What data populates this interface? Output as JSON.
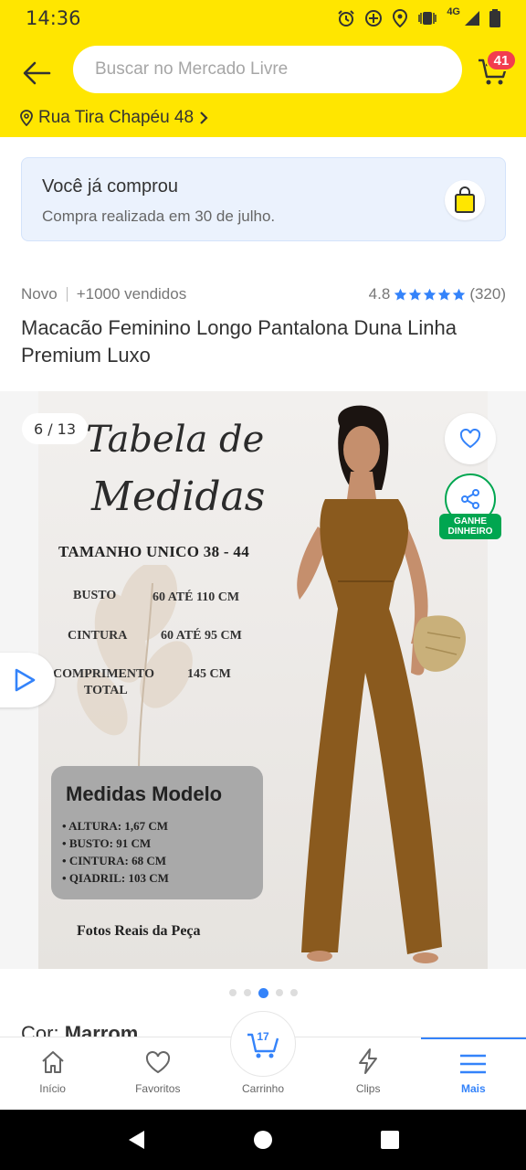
{
  "status_bar": {
    "time": "14:36",
    "network": "4G"
  },
  "header": {
    "search_placeholder": "Buscar no Mercado Livre",
    "cart_badge": "41",
    "address": "Rua Tira Chapéu 48"
  },
  "purchase_card": {
    "title": "Você já comprou",
    "subtitle": "Compra realizada em 30 de julho."
  },
  "product": {
    "condition": "Novo",
    "sold": "+1000 vendidos",
    "rating": "4.8",
    "rating_count": "(320)",
    "title": "Macacão Feminino Longo Pantalona Duna Linha Premium Luxo"
  },
  "gallery": {
    "counter": "6 / 13",
    "share_label_1": "GANHE",
    "share_label_2": "DINHEIRO",
    "image_text": {
      "script_line1": "Tabela de",
      "script_line2": "Medidas",
      "size_heading": "TAMANHO UNICO 38 - 44",
      "rows": [
        {
          "label": "BUSTO",
          "value": "60 ATÉ 110 CM"
        },
        {
          "label": "CINTURA",
          "value": "60 ATÉ 95 CM"
        },
        {
          "label": "COMPRIMENTO",
          "label2": "TOTAL",
          "value": "145 CM"
        }
      ],
      "model_title": "Medidas Modelo",
      "model_items": [
        "ALTURA: 1,67 CM",
        "BUSTO: 91 CM",
        "CINTURA: 68 CM",
        "QIADRIL: 103 CM"
      ],
      "footer": "Fotos Reais da Peça"
    },
    "dots_total": 5,
    "dots_active": 3
  },
  "color": {
    "label": "Cor:",
    "value": "Marrom"
  },
  "bottom_nav": {
    "items": [
      {
        "label": "Início",
        "icon": "home-icon"
      },
      {
        "label": "Favoritos",
        "icon": "heart-icon"
      },
      {
        "label": "Carrinho",
        "icon": "cart-icon",
        "count": "17"
      },
      {
        "label": "Clips",
        "icon": "lightning-icon"
      },
      {
        "label": "Mais",
        "icon": "menu-icon"
      }
    ]
  },
  "colors": {
    "brand_yellow": "#ffe600",
    "accent_blue": "#3483fa",
    "badge_red": "#f23d4f",
    "green": "#00a650",
    "jumpsuit": "#8a5a1e"
  }
}
